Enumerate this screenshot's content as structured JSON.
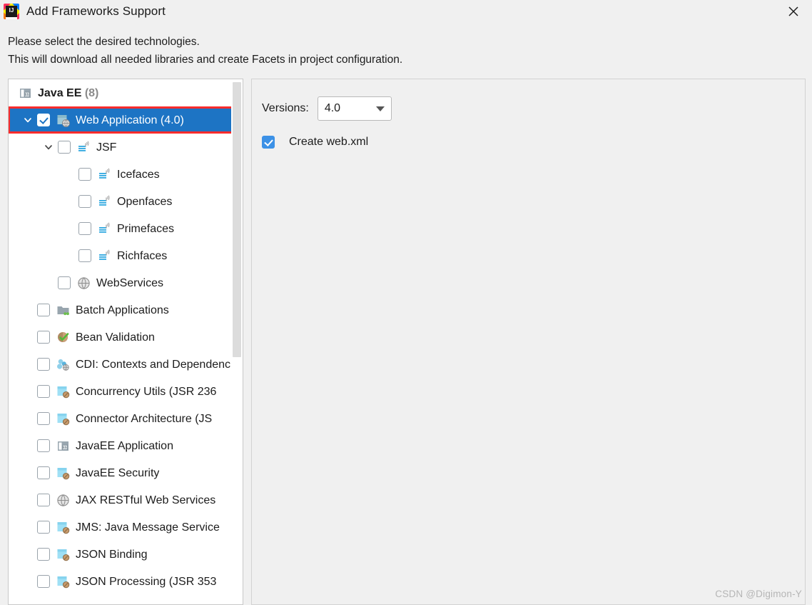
{
  "window": {
    "title": "Add Frameworks Support",
    "app_icon": "intellij-idea-icon",
    "close_label": "close-icon"
  },
  "description": {
    "line1": "Please select the desired technologies.",
    "line2": "This will download all needed libraries and create Facets in project configuration."
  },
  "tree": {
    "header": {
      "label": "Java EE",
      "count": "(8)",
      "icon": "javaee-icon"
    },
    "items": [
      {
        "label": "Web Application (4.0)",
        "icon": "web-application-icon",
        "depth": 0,
        "checked": true,
        "twisty": "expanded",
        "selected": true,
        "highlighted": true
      },
      {
        "label": "JSF",
        "icon": "jsf-icon",
        "depth": 1,
        "checked": false,
        "twisty": "expanded",
        "selected": false,
        "highlighted": false
      },
      {
        "label": "Icefaces",
        "icon": "jsf-icon",
        "depth": 2,
        "checked": false,
        "twisty": "none",
        "selected": false,
        "highlighted": false
      },
      {
        "label": "Openfaces",
        "icon": "jsf-icon",
        "depth": 2,
        "checked": false,
        "twisty": "none",
        "selected": false,
        "highlighted": false
      },
      {
        "label": "Primefaces",
        "icon": "jsf-icon",
        "depth": 2,
        "checked": false,
        "twisty": "none",
        "selected": false,
        "highlighted": false
      },
      {
        "label": "Richfaces",
        "icon": "jsf-icon",
        "depth": 2,
        "checked": false,
        "twisty": "none",
        "selected": false,
        "highlighted": false
      },
      {
        "label": "WebServices",
        "icon": "globe-icon",
        "depth": 1,
        "checked": false,
        "twisty": "none",
        "selected": false,
        "highlighted": false
      },
      {
        "label": "Batch Applications",
        "icon": "folder-icon",
        "depth": 0,
        "checked": false,
        "twisty": "none",
        "selected": false,
        "highlighted": false
      },
      {
        "label": "Bean Validation",
        "icon": "bean-validation-icon",
        "depth": 0,
        "checked": false,
        "twisty": "none",
        "selected": false,
        "highlighted": false
      },
      {
        "label": "CDI: Contexts and Dependenc",
        "icon": "cdi-icon",
        "depth": 0,
        "checked": false,
        "twisty": "none",
        "selected": false,
        "highlighted": false
      },
      {
        "label": "Concurrency Utils (JSR 236",
        "icon": "bean-icon",
        "depth": 0,
        "checked": false,
        "twisty": "none",
        "selected": false,
        "highlighted": false
      },
      {
        "label": "Connector Architecture (JS",
        "icon": "bean-icon",
        "depth": 0,
        "checked": false,
        "twisty": "none",
        "selected": false,
        "highlighted": false
      },
      {
        "label": "JavaEE Application",
        "icon": "javaee-icon",
        "depth": 0,
        "checked": false,
        "twisty": "none",
        "selected": false,
        "highlighted": false
      },
      {
        "label": "JavaEE Security",
        "icon": "bean-icon",
        "depth": 0,
        "checked": false,
        "twisty": "none",
        "selected": false,
        "highlighted": false
      },
      {
        "label": "JAX RESTful Web Services",
        "icon": "globe-icon",
        "depth": 0,
        "checked": false,
        "twisty": "none",
        "selected": false,
        "highlighted": false
      },
      {
        "label": "JMS: Java Message Service",
        "icon": "bean-icon",
        "depth": 0,
        "checked": false,
        "twisty": "none",
        "selected": false,
        "highlighted": false
      },
      {
        "label": "JSON Binding",
        "icon": "bean-icon",
        "depth": 0,
        "checked": false,
        "twisty": "none",
        "selected": false,
        "highlighted": false
      },
      {
        "label": "JSON Processing (JSR 353",
        "icon": "bean-icon",
        "depth": 0,
        "checked": false,
        "twisty": "none",
        "selected": false,
        "highlighted": false
      }
    ]
  },
  "details": {
    "versions_label": "Versions:",
    "version_selected": "4.0",
    "create_webxml_label": "Create web.xml",
    "create_webxml_checked": true
  },
  "watermark": "CSDN @Digimon-Y",
  "colors": {
    "selection": "#1d74c4",
    "annotation": "#fb2c2c",
    "checkbox_accent": "#3c91e6",
    "dialog_bg": "#f0f0f0",
    "tree_bg": "#ffffff"
  }
}
